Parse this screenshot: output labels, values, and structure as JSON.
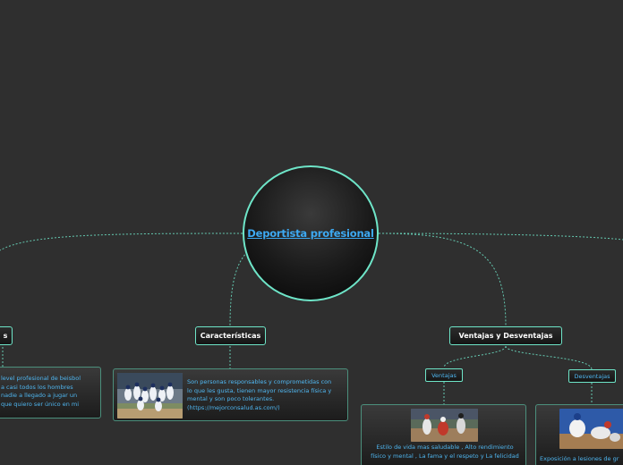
{
  "central": {
    "title": "Deportista profesional"
  },
  "topics": {
    "left_partial": "s",
    "caracteristicas": "Características",
    "ventajas_desventajas": "Ventajas  y  Desventajas",
    "ventajas": "Ventajas",
    "desventajas": "Desventajas"
  },
  "cards": {
    "left_lines": [
      "level profesional de beisbol",
      "a casi todos los hombres",
      "nadie a llegado a jugar un",
      "que quiero ser único en mi"
    ],
    "caracteristicas_lines": [
      "Son personas responsables y comprometidas con",
      "lo que les gusta, tienen mayor resistencia física y",
      "mental y son poco tolerantes.",
      "(https://mejorconsalud.as.com/)"
    ],
    "ventajas_lines": [
      "Estilo de vida mas saludable , Alto rendimiento",
      "físico y mental  , La fama y el respeto y La felicidad"
    ],
    "desventajas_text": "Exposición a lesiones de gr"
  },
  "colors": {
    "background": "#2f2f2f",
    "accent": "#6ee5c8",
    "link": "#3da9f2",
    "note_text": "#4fb6f0"
  }
}
